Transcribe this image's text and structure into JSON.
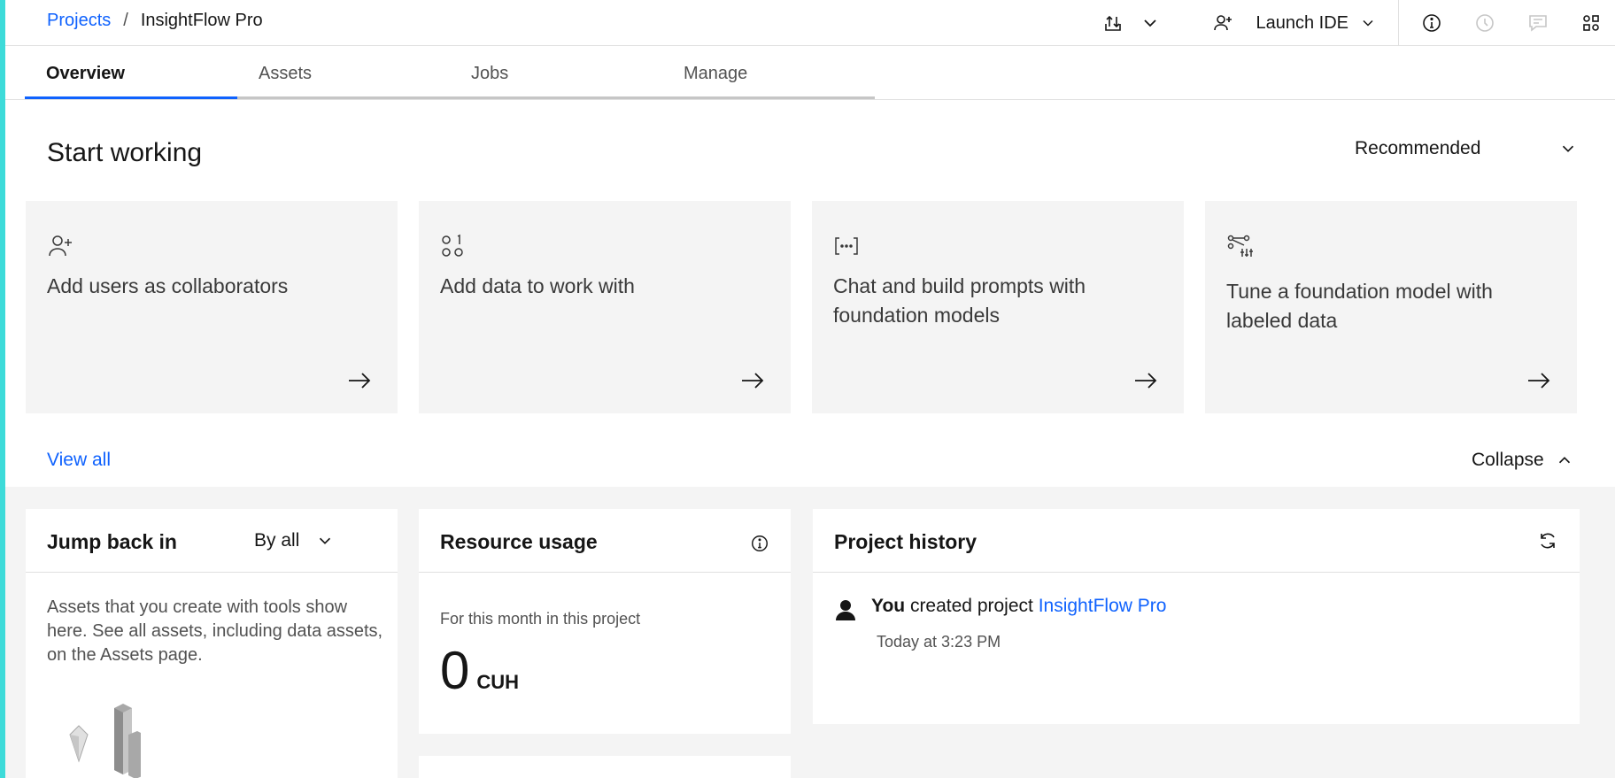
{
  "breadcrumb": {
    "root": "Projects",
    "separator": "/",
    "current": "InsightFlow Pro"
  },
  "header": {
    "launch_ide_label": "Launch IDE"
  },
  "tabs": [
    {
      "label": "Overview",
      "active": true
    },
    {
      "label": "Assets",
      "active": false
    },
    {
      "label": "Jobs",
      "active": false
    },
    {
      "label": "Manage",
      "active": false
    }
  ],
  "start_working": {
    "title": "Start working",
    "filter": "Recommended",
    "cards": [
      {
        "icon": "add-user-icon",
        "title": "Add users as collaborators"
      },
      {
        "icon": "data-icon",
        "title": "Add data to work with"
      },
      {
        "icon": "prompt-icon",
        "title": "Chat and build prompts with foundation models"
      },
      {
        "icon": "tuning-icon",
        "title": "Tune a foundation model with labeled data"
      }
    ],
    "view_all": "View all",
    "collapse": "Collapse"
  },
  "jump_back": {
    "title": "Jump back in",
    "filter": "By all",
    "description": "Assets that you create with tools show here. See all assets, including data assets, on the Assets page."
  },
  "resource_usage": {
    "title": "Resource usage",
    "subtitle": "For this month in this project",
    "value": "0",
    "unit": "CUH"
  },
  "project_history": {
    "title": "Project history",
    "entry": {
      "actor": "You",
      "action": " created project ",
      "target": "InsightFlow Pro",
      "time": "Today at 3:23 PM"
    }
  },
  "colors": {
    "accent": "#0f62fe",
    "side_strip": "#3ddbd9",
    "card_bg": "#f4f4f4"
  }
}
